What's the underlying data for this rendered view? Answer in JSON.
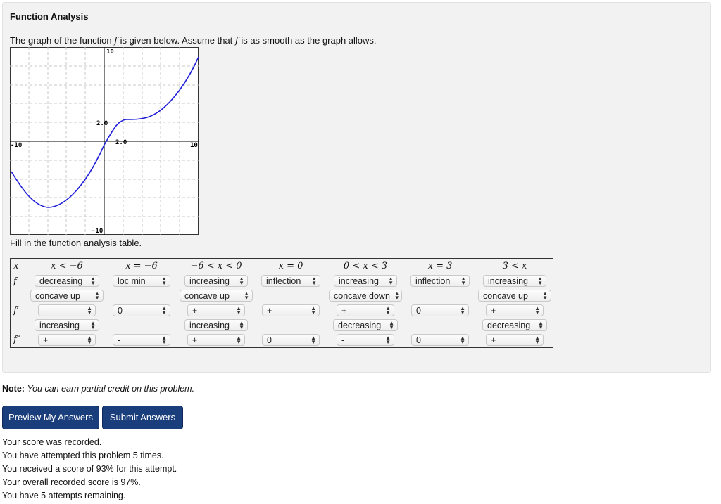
{
  "problem": {
    "title": "Function Analysis",
    "intro_before": "The graph of the function ",
    "intro_f1": "f",
    "intro_middle": " is given below. Assume that ",
    "intro_f2": "f",
    "intro_after": " is as smooth as the graph allows.",
    "fill_text": "Fill in the function analysis table."
  },
  "graph": {
    "labels": {
      "top": "10",
      "bottom": "-10",
      "left": "-10",
      "right": "10",
      "y_mid": "2.0",
      "x_mid": "2.0"
    },
    "curve_color": "#1f1fd8"
  },
  "table": {
    "row_labels": {
      "x": "x",
      "f": "f",
      "f1": "f′",
      "f2": "f″"
    },
    "headers": [
      "x < −6",
      "x = −6",
      "−6 < x < 0",
      "x = 0",
      "0 < x < 3",
      "x = 3",
      "3 < x"
    ],
    "f_row1": [
      "decreasing",
      "loc min",
      "increasing",
      "inflection",
      "increasing",
      "inflection",
      "increasing"
    ],
    "f_row2": [
      "concave up",
      "",
      "concave up",
      "",
      "concave down",
      "",
      "concave up"
    ],
    "f1_row1": [
      "-",
      "0",
      "+",
      "+",
      "+",
      "0",
      "+"
    ],
    "f1_row2": [
      "increasing",
      "",
      "increasing",
      "",
      "decreasing",
      "",
      "decreasing"
    ],
    "f2_row": [
      "+",
      "-",
      "+",
      "0",
      "-",
      "0",
      "+"
    ]
  },
  "note": {
    "label": "Note:",
    "text": "You can earn partial credit on this problem."
  },
  "buttons": {
    "preview": "Preview My Answers",
    "submit": "Submit Answers"
  },
  "messages": [
    "Your score was recorded.",
    "You have attempted this problem 5 times.",
    "You received a score of 93% for this attempt.",
    "Your overall recorded score is 97%.",
    "You have 5 attempts remaining."
  ]
}
